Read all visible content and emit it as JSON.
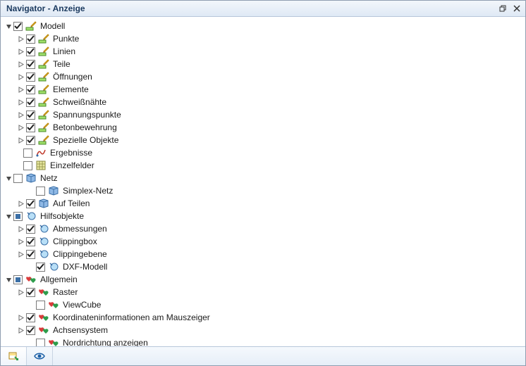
{
  "title": "Navigator - Anzeige",
  "icons": {
    "pencil": "pencil-icon",
    "result": "result-icon",
    "grid": "grid-icon",
    "mesh": "mesh-icon",
    "aux": "aux-icon",
    "hearts": "hearts-icon"
  },
  "tree": [
    {
      "label": "Modell",
      "icon": "pencil",
      "checkbox": "check",
      "checked": true,
      "expand": "open",
      "depth": 0
    },
    {
      "label": "Punkte",
      "icon": "pencil",
      "checkbox": "check",
      "checked": true,
      "expand": "closed",
      "depth": 1
    },
    {
      "label": "Linien",
      "icon": "pencil",
      "checkbox": "check",
      "checked": true,
      "expand": "closed",
      "depth": 1
    },
    {
      "label": "Teile",
      "icon": "pencil",
      "checkbox": "check",
      "checked": true,
      "expand": "closed",
      "depth": 1
    },
    {
      "label": "Öffnungen",
      "icon": "pencil",
      "checkbox": "check",
      "checked": true,
      "expand": "closed",
      "depth": 1
    },
    {
      "label": "Elemente",
      "icon": "pencil",
      "checkbox": "check",
      "checked": true,
      "expand": "closed",
      "depth": 1
    },
    {
      "label": "Schweißnähte",
      "icon": "pencil",
      "checkbox": "check",
      "checked": true,
      "expand": "closed",
      "depth": 1
    },
    {
      "label": "Spannungspunkte",
      "icon": "pencil",
      "checkbox": "check",
      "checked": true,
      "expand": "closed",
      "depth": 1
    },
    {
      "label": "Betonbewehrung",
      "icon": "pencil",
      "checkbox": "check",
      "checked": true,
      "expand": "closed",
      "depth": 1
    },
    {
      "label": "Spezielle Objekte",
      "icon": "pencil",
      "checkbox": "check",
      "checked": true,
      "expand": "closed",
      "depth": 1
    },
    {
      "label": "Ergebnisse",
      "icon": "result",
      "checkbox": "check",
      "checked": false,
      "expand": "none",
      "depth": 0,
      "noexpander": true,
      "indent": 1
    },
    {
      "label": "Einzelfelder",
      "icon": "grid",
      "checkbox": "check",
      "checked": false,
      "expand": "none",
      "depth": 0,
      "noexpander": true,
      "indent": 1
    },
    {
      "label": "Netz",
      "icon": "mesh",
      "checkbox": "check",
      "checked": false,
      "expand": "open",
      "depth": 0
    },
    {
      "label": "Simplex-Netz",
      "icon": "mesh",
      "checkbox": "check",
      "checked": false,
      "expand": "none",
      "depth": 1,
      "noexpander": true,
      "indent": 1
    },
    {
      "label": "Auf Teilen",
      "icon": "mesh",
      "checkbox": "check",
      "checked": true,
      "expand": "closed",
      "depth": 1
    },
    {
      "label": "Hilfsobjekte",
      "icon": "aux",
      "checkbox": "square",
      "checked": true,
      "expand": "open",
      "depth": 0
    },
    {
      "label": "Abmessungen",
      "icon": "aux",
      "checkbox": "check",
      "checked": true,
      "expand": "closed",
      "depth": 1
    },
    {
      "label": "Clippingbox",
      "icon": "aux",
      "checkbox": "check",
      "checked": true,
      "expand": "closed",
      "depth": 1
    },
    {
      "label": "Clippingebene",
      "icon": "aux",
      "checkbox": "check",
      "checked": true,
      "expand": "closed",
      "depth": 1
    },
    {
      "label": "DXF-Modell",
      "icon": "aux",
      "checkbox": "check",
      "checked": true,
      "expand": "none",
      "depth": 1,
      "noexpander": true,
      "indent": 1
    },
    {
      "label": "Allgemein",
      "icon": "hearts",
      "checkbox": "square",
      "checked": true,
      "expand": "open",
      "depth": 0
    },
    {
      "label": "Raster",
      "icon": "hearts",
      "checkbox": "check",
      "checked": true,
      "expand": "closed",
      "depth": 1
    },
    {
      "label": "ViewCube",
      "icon": "hearts",
      "checkbox": "check",
      "checked": false,
      "expand": "none",
      "depth": 1,
      "noexpander": true,
      "indent": 1
    },
    {
      "label": "Koordinateninformationen am Mauszeiger",
      "icon": "hearts",
      "checkbox": "check",
      "checked": true,
      "expand": "closed",
      "depth": 1
    },
    {
      "label": "Achsensystem",
      "icon": "hearts",
      "checkbox": "check",
      "checked": true,
      "expand": "closed",
      "depth": 1
    },
    {
      "label": "Nordrichtung anzeigen",
      "icon": "hearts",
      "checkbox": "check",
      "checked": false,
      "expand": "none",
      "depth": 1,
      "noexpander": true,
      "indent": 1
    }
  ],
  "footer_tabs": [
    {
      "name": "view-tab",
      "icon": "ftab1",
      "active": true
    },
    {
      "name": "eye-tab",
      "icon": "ftab2",
      "active": false
    }
  ]
}
